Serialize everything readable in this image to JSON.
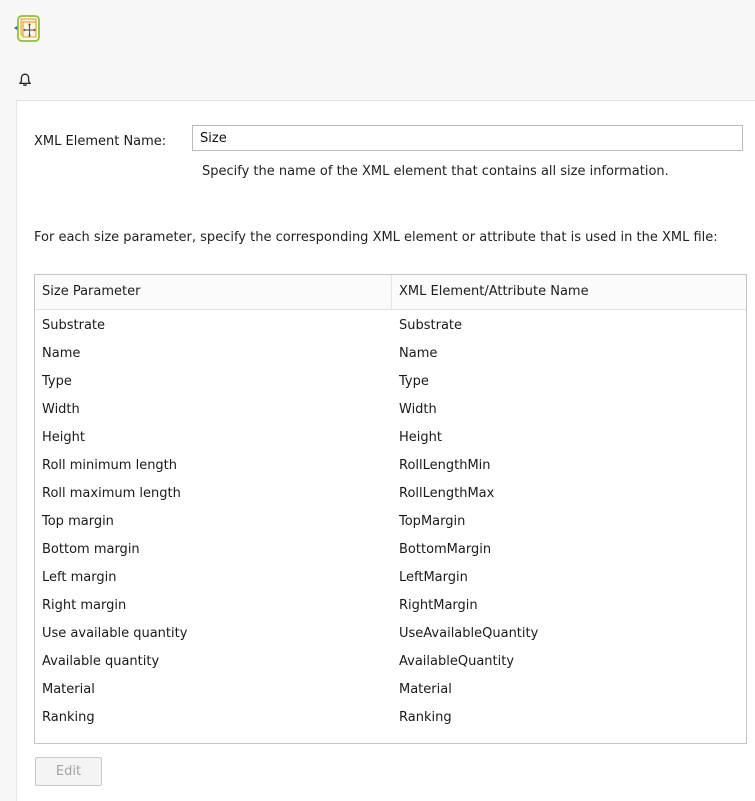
{
  "icons": {
    "node": "move-node-icon",
    "bell": "bell-icon"
  },
  "colors": {
    "node_border": "#8fbf3a",
    "node_fill": "#fdf3d6",
    "node_accent": "#e8a33a",
    "arrow": "#1f6fb2"
  },
  "form": {
    "element_name_label": "XML Element Name:",
    "element_name_value": "Size",
    "element_name_hint": "Specify the name of the XML element that contains all size information.",
    "instruction": "For each size parameter, specify the corresponding XML element or attribute that is used in the XML file:"
  },
  "table": {
    "columns": [
      "Size Parameter",
      "XML Element/Attribute Name"
    ],
    "rows": [
      [
        "Substrate",
        "Substrate"
      ],
      [
        "Name",
        "Name"
      ],
      [
        "Type",
        "Type"
      ],
      [
        "Width",
        "Width"
      ],
      [
        "Height",
        "Height"
      ],
      [
        "Roll minimum length",
        "RollLengthMin"
      ],
      [
        "Roll maximum length",
        "RollLengthMax"
      ],
      [
        "Top margin",
        "TopMargin"
      ],
      [
        "Bottom margin",
        "BottomMargin"
      ],
      [
        "Left margin",
        "LeftMargin"
      ],
      [
        "Right margin",
        "RightMargin"
      ],
      [
        "Use available quantity",
        "UseAvailableQuantity"
      ],
      [
        "Available quantity",
        "AvailableQuantity"
      ],
      [
        "Material",
        "Material"
      ],
      [
        "Ranking",
        "Ranking"
      ]
    ]
  },
  "buttons": {
    "edit_label": "Edit",
    "edit_enabled": false
  }
}
